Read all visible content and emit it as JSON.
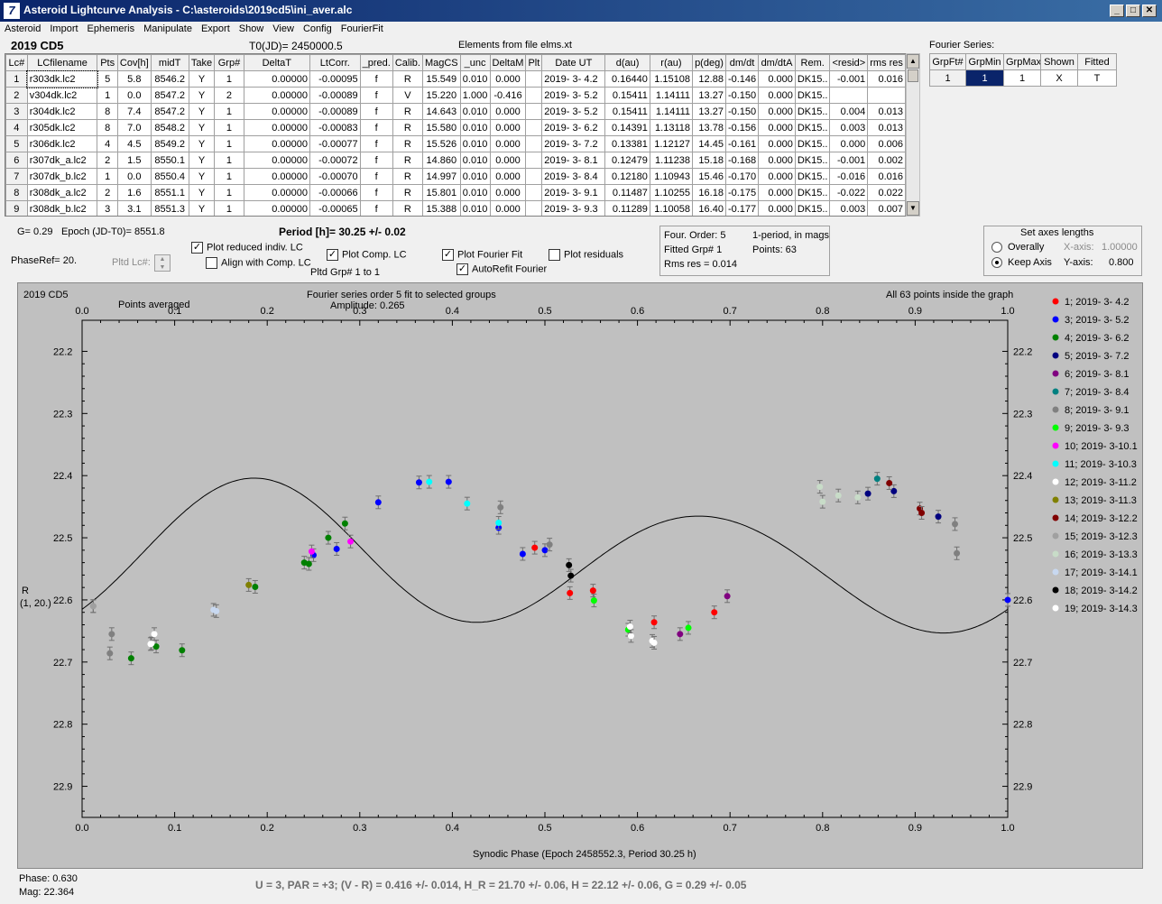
{
  "window": {
    "title": "Asteroid Lightcurve Analysis - C:\\asteroids\\2019cd5\\ini_aver.alc",
    "icon": "7"
  },
  "menu": [
    "Asteroid",
    "Import",
    "Ephemeris",
    "Manipulate",
    "Export",
    "Show",
    "View",
    "Config",
    "FourierFit"
  ],
  "header": {
    "object": "2019 CD5",
    "t0": "T0(JD)= 2450000.5",
    "elements": "Elements from file elms.xt",
    "fourier_series_label": "Fourier Series:"
  },
  "lc_table": {
    "columns": [
      "Lc#",
      "LCfilename",
      "Pts",
      "Cov[h]",
      "midT",
      "Take",
      "Grp#",
      "DeltaT",
      "LtCorr.",
      "_pred.",
      "Calib.",
      "MagCS",
      "_unc",
      "DeltaM",
      "Plt",
      "Date UT",
      "d(au)",
      "r(au)",
      "p(deg)",
      "dm/dt",
      "dm/dtA",
      "Rem.",
      "<resid>",
      "rms res"
    ],
    "rows": [
      [
        "1",
        "r303dk.lc2",
        "5",
        "5.8",
        "8546.2",
        "Y",
        "1",
        "0.00000",
        "-0.00095",
        "f",
        "R",
        "15.549",
        "0.010",
        "0.000",
        "",
        "2019- 3- 4.2",
        "0.16440",
        "1.15108",
        "12.88",
        "-0.146",
        "0.000",
        "DK15..",
        "-0.001",
        "0.016"
      ],
      [
        "2",
        "v304dk.lc2",
        "1",
        "0.0",
        "8547.2",
        "Y",
        "2",
        "0.00000",
        "-0.00089",
        "f",
        "V",
        "15.220",
        "1.000",
        "-0.416",
        "",
        "2019- 3- 5.2",
        "0.15411",
        "1.14111",
        "13.27",
        "-0.150",
        "0.000",
        "DK15..",
        "",
        ""
      ],
      [
        "3",
        "r304dk.lc2",
        "8",
        "7.4",
        "8547.2",
        "Y",
        "1",
        "0.00000",
        "-0.00089",
        "f",
        "R",
        "14.643",
        "0.010",
        "0.000",
        "",
        "2019- 3- 5.2",
        "0.15411",
        "1.14111",
        "13.27",
        "-0.150",
        "0.000",
        "DK15..",
        "0.004",
        "0.013"
      ],
      [
        "4",
        "r305dk.lc2",
        "8",
        "7.0",
        "8548.2",
        "Y",
        "1",
        "0.00000",
        "-0.00083",
        "f",
        "R",
        "15.580",
        "0.010",
        "0.000",
        "",
        "2019- 3- 6.2",
        "0.14391",
        "1.13118",
        "13.78",
        "-0.156",
        "0.000",
        "DK15..",
        "0.003",
        "0.013"
      ],
      [
        "5",
        "r306dk.lc2",
        "4",
        "4.5",
        "8549.2",
        "Y",
        "1",
        "0.00000",
        "-0.00077",
        "f",
        "R",
        "15.526",
        "0.010",
        "0.000",
        "",
        "2019- 3- 7.2",
        "0.13381",
        "1.12127",
        "14.45",
        "-0.161",
        "0.000",
        "DK15..",
        "0.000",
        "0.006"
      ],
      [
        "6",
        "r307dk_a.lc2",
        "2",
        "1.5",
        "8550.1",
        "Y",
        "1",
        "0.00000",
        "-0.00072",
        "f",
        "R",
        "14.860",
        "0.010",
        "0.000",
        "",
        "2019- 3- 8.1",
        "0.12479",
        "1.11238",
        "15.18",
        "-0.168",
        "0.000",
        "DK15..",
        "-0.001",
        "0.002"
      ],
      [
        "7",
        "r307dk_b.lc2",
        "1",
        "0.0",
        "8550.4",
        "Y",
        "1",
        "0.00000",
        "-0.00070",
        "f",
        "R",
        "14.997",
        "0.010",
        "0.000",
        "",
        "2019- 3- 8.4",
        "0.12180",
        "1.10943",
        "15.46",
        "-0.170",
        "0.000",
        "DK15..",
        "-0.016",
        "0.016"
      ],
      [
        "8",
        "r308dk_a.lc2",
        "2",
        "1.6",
        "8551.1",
        "Y",
        "1",
        "0.00000",
        "-0.00066",
        "f",
        "R",
        "15.801",
        "0.010",
        "0.000",
        "",
        "2019- 3- 9.1",
        "0.11487",
        "1.10255",
        "16.18",
        "-0.175",
        "0.000",
        "DK15..",
        "-0.022",
        "0.022"
      ],
      [
        "9",
        "r308dk_b.lc2",
        "3",
        "3.1",
        "8551.3",
        "Y",
        "1",
        "0.00000",
        "-0.00065",
        "f",
        "R",
        "15.388",
        "0.010",
        "0.000",
        "",
        "2019- 3- 9.3",
        "0.11289",
        "1.10058",
        "16.40",
        "-0.177",
        "0.000",
        "DK15..",
        "0.003",
        "0.007"
      ]
    ]
  },
  "fourier_table": {
    "columns": [
      "GrpFt#",
      "GrpMin",
      "GrpMax",
      "Shown",
      "Fitted"
    ],
    "row": [
      "1",
      "1",
      "1",
      "X",
      "T"
    ]
  },
  "params": {
    "g": "G= 0.29",
    "epoch": "Epoch (JD-T0)= 8551.8",
    "period": "Period [h]= 30.25 +/- 0.02",
    "phaseref": "PhaseRef= 20.",
    "pltd_lc": "Pltd Lc#:"
  },
  "checks": {
    "plot_reduced": {
      "label": "Plot reduced indiv. LC",
      "checked": true
    },
    "align_comp": {
      "label": "Align with Comp. LC",
      "checked": false
    },
    "plot_comp": {
      "label": "Plot Comp. LC",
      "checked": true
    },
    "pltd_grp": "Pltd Grp#  1   to   1",
    "plot_fourier": {
      "label": "Plot Fourier Fit",
      "checked": true
    },
    "autorefit": {
      "label": "AutoRefit Fourier",
      "checked": true
    },
    "plot_residuals": {
      "label": "Plot residuals",
      "checked": false
    }
  },
  "fourier_info": {
    "order": "Four. Order:  5",
    "mode": "1-period, in mags",
    "fitted": "Fitted Grp# 1",
    "points": "Points: 63",
    "rms": "Rms res     = 0.014"
  },
  "axes_panel": {
    "title": "Set axes lengths",
    "overall": "Overally",
    "keep": "Keep Axis",
    "xaxis_label": "X-axis:",
    "xaxis_value": "1.00000",
    "yaxis_label": "Y-axis:",
    "yaxis_value": "0.800"
  },
  "plot_text": {
    "object": "2019 CD5",
    "points_averaged": "Points averaged",
    "fourier_title": "Fourier series order 5 fit to selected groups",
    "amplitude": "Amplitude: 0.265",
    "inside": "All 63 points inside the graph",
    "ylabel1": "R",
    "ylabel2": "(1, 20.)",
    "xlabel": "Synodic Phase (Epoch 2458552.3, Period 30.25 h)"
  },
  "footer": {
    "phase": "Phase:  0.630",
    "mag": "Mag:    22.364",
    "status": "U = 3, PAR = +3; (V - R) = 0.416 +/- 0.014, H_R = 21.70 +/- 0.06, H = 22.12 +/- 0.06, G = 0.29 +/- 0.05"
  },
  "chart_data": {
    "type": "scatter",
    "title": "Fourier series order 5 fit to selected groups",
    "xlabel": "Synodic Phase (Epoch 2458552.3, Period 30.25 h)",
    "ylabel": "R (1, 20.)",
    "xlim": [
      0.0,
      1.0
    ],
    "ylim": [
      22.95,
      22.15
    ],
    "y_inverted": true,
    "xticks": [
      "0.0",
      "0.1",
      "0.2",
      "0.3",
      "0.4",
      "0.5",
      "0.6",
      "0.7",
      "0.8",
      "0.9",
      "1.0"
    ],
    "yticks": [
      "22.2",
      "22.3",
      "22.4",
      "22.5",
      "22.6",
      "22.7",
      "22.8",
      "22.9"
    ],
    "fourier_fit": {
      "mean": 22.54,
      "amplitude": 0.265,
      "line_color": "#000000"
    },
    "series": [
      {
        "name": "1; 2019- 3- 4.2",
        "color": "#ff0000",
        "points": [
          [
            0.489,
            22.516
          ],
          [
            0.527,
            22.589
          ],
          [
            0.552,
            22.585
          ],
          [
            0.618,
            22.636
          ],
          [
            0.683,
            22.62
          ]
        ]
      },
      {
        "name": "3; 2019- 3- 5.2",
        "color": "#0000ff",
        "points": [
          [
            0.25,
            22.528
          ],
          [
            0.275,
            22.518
          ],
          [
            0.32,
            22.443
          ],
          [
            0.364,
            22.411
          ],
          [
            0.396,
            22.41
          ],
          [
            0.45,
            22.484
          ],
          [
            0.476,
            22.526
          ],
          [
            0.5,
            22.52
          ],
          [
            1.0,
            22.6
          ]
        ]
      },
      {
        "name": "4; 2019- 3- 6.2",
        "color": "#008000",
        "points": [
          [
            0.053,
            22.694
          ],
          [
            0.08,
            22.675
          ],
          [
            0.108,
            22.681
          ],
          [
            0.187,
            22.579
          ],
          [
            0.24,
            22.54
          ],
          [
            0.245,
            22.542
          ],
          [
            0.266,
            22.5
          ],
          [
            0.284,
            22.477
          ]
        ]
      },
      {
        "name": "5; 2019- 3- 7.2",
        "color": "#00007f",
        "points": [
          [
            0.849,
            22.429
          ],
          [
            0.877,
            22.425
          ],
          [
            0.925,
            22.466
          ]
        ]
      },
      {
        "name": "6; 2019- 3- 8.1",
        "color": "#800080",
        "points": [
          [
            0.646,
            22.655
          ],
          [
            0.697,
            22.594
          ]
        ]
      },
      {
        "name": "7; 2019- 3- 8.4",
        "color": "#008080",
        "points": [
          [
            0.859,
            22.405
          ]
        ]
      },
      {
        "name": "8; 2019- 3- 9.1",
        "color": "#808080",
        "points": [
          [
            0.012,
            22.61
          ],
          [
            0.032,
            22.655
          ],
          [
            0.03,
            22.686
          ],
          [
            0.452,
            22.451
          ],
          [
            0.505,
            22.511
          ],
          [
            0.943,
            22.478
          ],
          [
            0.945,
            22.525
          ]
        ]
      },
      {
        "name": "9; 2019- 3- 9.3",
        "color": "#00ff00",
        "points": [
          [
            0.553,
            22.601
          ],
          [
            0.59,
            22.648
          ],
          [
            0.655,
            22.645
          ]
        ]
      },
      {
        "name": "10; 2019- 3-10.1",
        "color": "#ff00ff",
        "points": [
          [
            0.248,
            22.522
          ],
          [
            0.29,
            22.506
          ]
        ]
      },
      {
        "name": "11; 2019- 3-10.3",
        "color": "#00ffff",
        "points": [
          [
            0.375,
            22.41
          ],
          [
            0.416,
            22.445
          ],
          [
            0.45,
            22.476
          ]
        ]
      },
      {
        "name": "12; 2019- 3-11.2",
        "color": "#ffffff",
        "points": [
          [
            0.075,
            22.67
          ],
          [
            0.078,
            22.655
          ],
          [
            0.593,
            22.658
          ],
          [
            0.592,
            22.643
          ],
          [
            0.616,
            22.666
          ],
          [
            0.618,
            22.669
          ]
        ]
      },
      {
        "name": "13; 2019- 3-11.3",
        "color": "#808000",
        "points": [
          [
            0.18,
            22.576
          ]
        ]
      },
      {
        "name": "14; 2019- 3-12.2",
        "color": "#800000",
        "points": [
          [
            0.872,
            22.412
          ],
          [
            0.905,
            22.453
          ],
          [
            0.907,
            22.46
          ]
        ]
      },
      {
        "name": "15; 2019- 3-12.3",
        "color": "#a0a0a0",
        "points": [
          [
            0.012,
            22.61
          ]
        ]
      },
      {
        "name": "16; 2019- 3-13.3",
        "color": "#c8dcc8",
        "points": [
          [
            0.797,
            22.418
          ],
          [
            0.8,
            22.442
          ],
          [
            0.817,
            22.432
          ],
          [
            0.838,
            22.435
          ]
        ]
      },
      {
        "name": "17; 2019- 3-14.1",
        "color": "#c8d8f0",
        "points": [
          [
            0.142,
            22.616
          ],
          [
            0.145,
            22.618
          ]
        ]
      },
      {
        "name": "18; 2019- 3-14.2",
        "color": "#000000",
        "points": [
          [
            0.526,
            22.544
          ],
          [
            0.528,
            22.561
          ]
        ]
      },
      {
        "name": "19; 2019- 3-14.3",
        "color": "#ffffff",
        "points": [
          [
            0.074,
            22.671
          ]
        ]
      }
    ]
  }
}
